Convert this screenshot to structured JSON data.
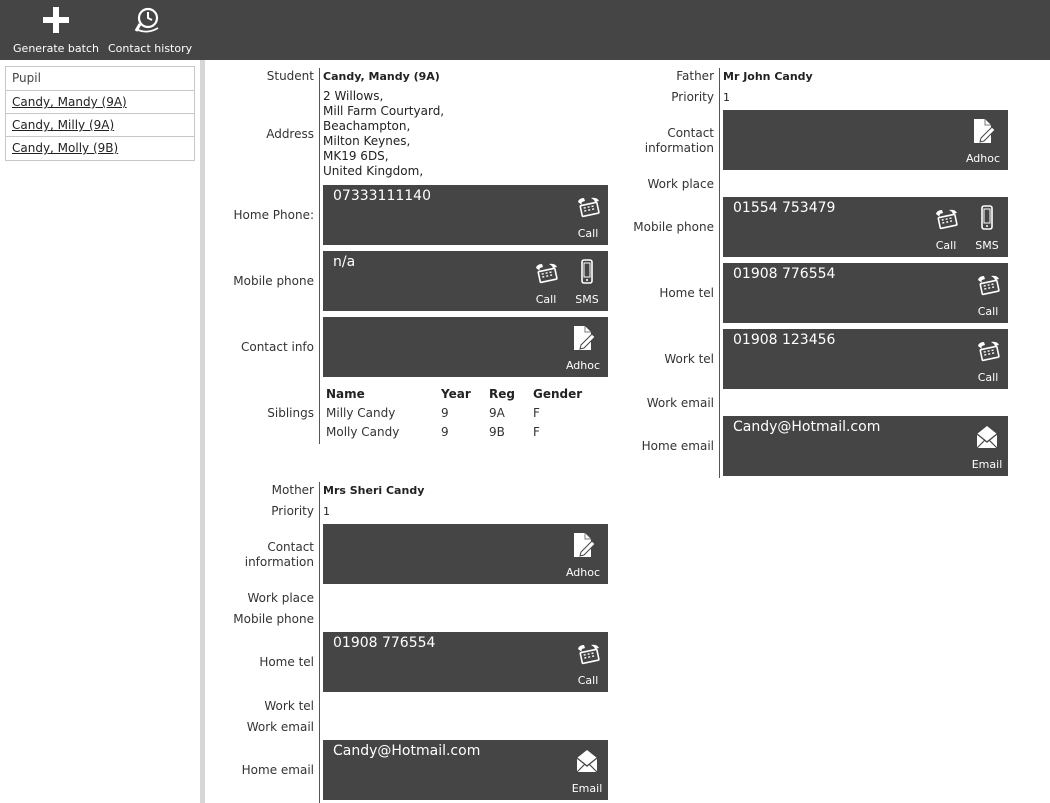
{
  "toolbar": {
    "generate_batch": "Generate batch",
    "contact_history": "Contact history"
  },
  "sidebar": {
    "header": "Pupil",
    "items": [
      "Candy, Mandy (9A)",
      "Candy, Milly (9A)",
      "Candy, Molly (9B)"
    ]
  },
  "student": {
    "label": "Student",
    "name": "Candy, Mandy (9A)",
    "address_label": "Address",
    "address_lines": [
      "2 Willows,",
      "Mill Farm Courtyard,",
      "Beachampton,",
      "Milton Keynes,",
      "MK19 6DS,",
      "United Kingdom,"
    ],
    "home_phone_label": "Home Phone:",
    "home_phone": "07333111140",
    "mobile_label": "Mobile phone",
    "mobile": "n/a",
    "contact_info_label": "Contact info",
    "siblings_label": "Siblings",
    "siblings_headers": [
      "Name",
      "Year",
      "Reg",
      "Gender"
    ],
    "siblings": [
      [
        "Milly Candy",
        "9",
        "9A",
        "F"
      ],
      [
        "Molly Candy",
        "9",
        "9B",
        "F"
      ]
    ]
  },
  "mother": {
    "label": "Mother",
    "name": "Mrs Sheri Candy",
    "priority_label": "Priority",
    "priority": "1",
    "contact_info_label_1": "Contact",
    "contact_info_label_2": "information",
    "work_place_label": "Work place",
    "mobile_label": "Mobile phone",
    "home_tel_label": "Home tel",
    "home_tel": "01908 776554",
    "work_tel_label": "Work tel",
    "work_email_label": "Work email",
    "home_email_label": "Home email",
    "home_email": "Candy@Hotmail.com"
  },
  "father": {
    "label": "Father",
    "name": "Mr John Candy",
    "priority_label": "Priority",
    "priority": "1",
    "contact_info_label_1": "Contact",
    "contact_info_label_2": "information",
    "work_place_label": "Work place",
    "mobile_label": "Mobile phone",
    "mobile": "01554 753479",
    "home_tel_label": "Home tel",
    "home_tel": "01908 776554",
    "work_tel_label": "Work tel",
    "work_tel": "01908 123456",
    "work_email_label": "Work email",
    "home_email_label": "Home email",
    "home_email": "Candy@Hotmail.com"
  },
  "actions": {
    "call": "Call",
    "sms": "SMS",
    "adhoc": "Adhoc",
    "email": "Email"
  },
  "icons": {
    "generate": "plus-icon",
    "history": "clock-magnifier-icon",
    "call": "phone-icon",
    "sms": "mobile-icon",
    "adhoc": "note-pencil-icon",
    "email": "envelope-icon"
  },
  "colors": {
    "toolbar_bg": "#454545",
    "box_bg": "#454545",
    "splitter": "#d6d6d6"
  }
}
